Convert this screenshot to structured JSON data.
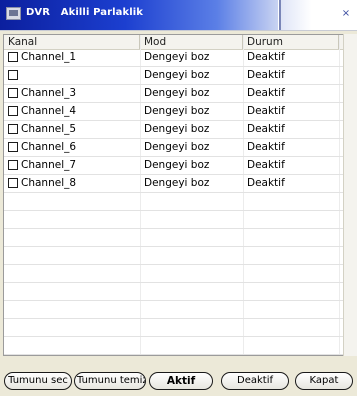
{
  "window": {
    "title": "DVR   Akilli Parlaklik",
    "close_glyph": "×"
  },
  "columns": [
    "Kanal",
    "Mod",
    "Durum"
  ],
  "rows": [
    {
      "kanal": "Channel_1",
      "mod": "Dengeyi boz",
      "durum": "Deaktif"
    },
    {
      "kanal": "",
      "mod": "Dengeyi boz",
      "durum": "Deaktif"
    },
    {
      "kanal": "Channel_3",
      "mod": "Dengeyi boz",
      "durum": "Deaktif"
    },
    {
      "kanal": "Channel_4",
      "mod": "Dengeyi boz",
      "durum": "Deaktif"
    },
    {
      "kanal": "Channel_5",
      "mod": "Dengeyi boz",
      "durum": "Deaktif"
    },
    {
      "kanal": "Channel_6",
      "mod": "Dengeyi boz",
      "durum": "Deaktif"
    },
    {
      "kanal": "Channel_7",
      "mod": "Dengeyi boz",
      "durum": "Deaktif"
    },
    {
      "kanal": "Channel_8",
      "mod": "Dengeyi boz",
      "durum": "Deaktif"
    }
  ],
  "buttons": {
    "select_all": "Tumunu sec",
    "clear_all": "Tumunu temizle",
    "activate": "Aktif",
    "deactivate": "Deaktif",
    "close": "Kapat"
  },
  "icons": {
    "app": "dvr-app-icon",
    "close": "close-icon",
    "checkbox": "checkbox-icon"
  }
}
